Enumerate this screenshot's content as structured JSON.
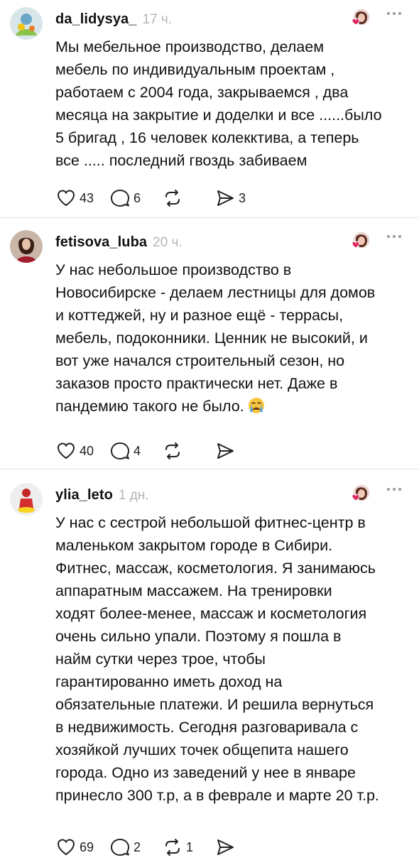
{
  "posts": [
    {
      "username": "da_lidysya_",
      "time": "17 ч.",
      "avatar_icon": "user-avatar-icon",
      "lines": [
        "Мы мебельное производство, делаем",
        "мебель по индивидуальным проектам ,",
        "работаем с 2004 года, закрываемся ,  два",
        "месяца на закрытие и доделки и все ......было",
        "5 бригад , 16 человек колекктива, а теперь",
        "все ..... последний гвоздь забиваем"
      ],
      "likes": "43",
      "comments": "6",
      "reposts": "",
      "shares": "3"
    },
    {
      "username": "fetisova_luba",
      "time": "20 ч.",
      "avatar_icon": "user-avatar-icon",
      "lines": [
        "У нас небольшое производство в",
        "Новосибирске - делаем лестницы для домов",
        "и коттеджей, ну и разное ещё - террасы,",
        "мебель, подоконники. Ценник не высокий, и",
        "вот уже начался строительный сезон, но",
        "заказов просто практически нет. Даже в",
        "пандемию такого не было."
      ],
      "emoji": "crying-face-icon",
      "likes": "40",
      "comments": "4",
      "reposts": "",
      "shares": ""
    },
    {
      "username": "ylia_leto",
      "time": "1 дн.",
      "avatar_icon": "user-avatar-icon",
      "lines": [
        "У нас с сестрой небольшой фитнес-центр в",
        "маленьком закрытом городе в Сибири.",
        "Фитнес, массаж, косметология. Я занимаюсь",
        "аппаратным массажем. На тренировки",
        "ходят более-менее, массаж и косметология",
        "очень сильно упали. Поэтому я пошла в",
        "найм сутки через трое, чтобы",
        "гарантированно иметь доход на",
        "обязательные платежи. И решила вернуться",
        "в недвижимость. Сегодня разговаривала с",
        "хозяйкой лучших точек общепита нашего",
        "города. Одно из заведений у нее в январе",
        "принесло 300 т.р, а в феврале и марте 20 т.р."
      ],
      "likes": "69",
      "comments": "2",
      "reposts": "1",
      "shares": ""
    }
  ],
  "icons": {
    "like": "heart-icon",
    "comment": "comment-icon",
    "repost": "repost-icon",
    "share": "share-icon",
    "more": "more-options-icon",
    "reaction": "reaction-avatar-icon"
  },
  "colors": {
    "text": "#111111",
    "muted": "#b5b5b5",
    "heart_badge": "#e0245e",
    "divider": "#e4e4e4"
  }
}
